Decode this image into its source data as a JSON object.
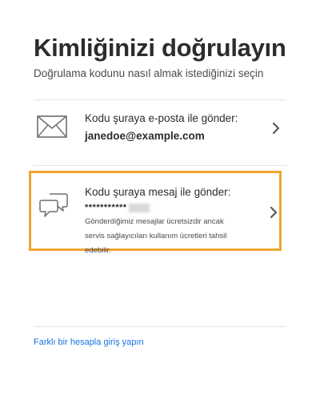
{
  "header": {
    "title": "Kimliğinizi doğrulayın",
    "subtitle": "Doğrulama kodunu nasıl almak istediğinizi seçin"
  },
  "options": {
    "email": {
      "label": "Kodu şuraya e-posta ile gönder:",
      "value": "janedoe@example.com",
      "icon": "envelope-icon"
    },
    "sms": {
      "label": "Kodu şuraya mesaj ile gönder:",
      "value": "***********",
      "note": "Gönderdiğimiz mesajlar ücretsizdir ancak servis sağlayıcıları kullanım ücretleri tahsil edebilir.",
      "icon": "chat-bubbles-icon",
      "highlight_color": "#f0a630"
    }
  },
  "footer": {
    "switch_account_link": "Farklı bir hesapla giriş yapın"
  },
  "colors": {
    "text": "#2c2c2c",
    "link": "#1473e6",
    "divider": "#e6e6e6"
  }
}
